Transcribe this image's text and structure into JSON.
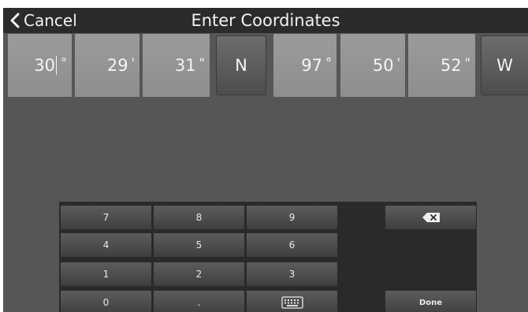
{
  "header": {
    "cancel_label": "Cancel",
    "title": "Enter Coordinates"
  },
  "coordinates": {
    "latitude": {
      "degrees": "30",
      "minutes": "29",
      "seconds": "31",
      "hemisphere": "N"
    },
    "longitude": {
      "degrees": "97",
      "minutes": "50",
      "seconds": "52",
      "hemisphere": "W"
    },
    "units": {
      "degrees": "°",
      "minutes": "'",
      "seconds": "\""
    }
  },
  "keypad": {
    "k7": "7",
    "k8": "8",
    "k9": "9",
    "k4": "4",
    "k5": "5",
    "k6": "6",
    "k1": "1",
    "k2": "2",
    "k3": "3",
    "k0": "0",
    "dot": ".",
    "done": "Done",
    "icons": {
      "backspace": "backspace-icon",
      "keyboard": "keyboard-icon"
    }
  },
  "colors": {
    "background": "#565656",
    "header": "#2b2b2b",
    "field": "#9b9b9b",
    "keypad": "#2a2a2a"
  }
}
